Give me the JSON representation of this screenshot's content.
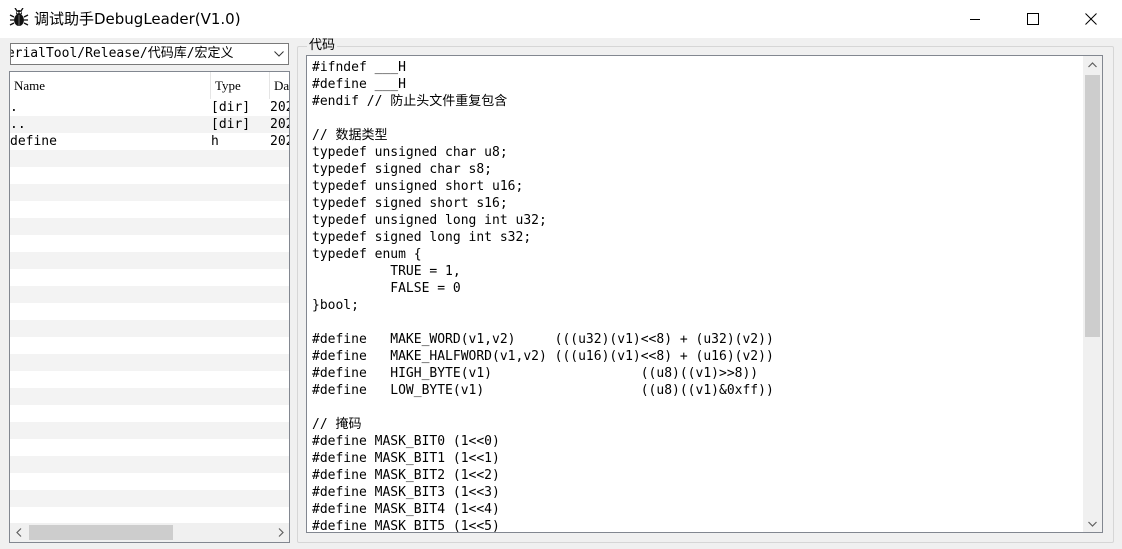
{
  "window": {
    "title": "调试助手DebugLeader(V1.0)",
    "minimize_glyph": "—",
    "maximize_glyph": "☐",
    "close_glyph": "✕"
  },
  "path_combo": {
    "value": "SerialTool/Release/代码库/宏定义"
  },
  "file_list": {
    "columns": [
      "Name",
      "Type",
      "Da"
    ],
    "rows": [
      {
        "name": ".",
        "type": "[dir]",
        "date": "202"
      },
      {
        "name": "..",
        "type": "[dir]",
        "date": "202"
      },
      {
        "name": "define",
        "type": "h",
        "date": "202"
      }
    ]
  },
  "code_panel": {
    "label": "代码",
    "lines": [
      "#ifndef ___H",
      "#define ___H",
      "#endif // 防止头文件重复包含",
      "",
      "// 数据类型",
      "typedef unsigned char u8;",
      "typedef signed char s8;",
      "typedef unsigned short u16;",
      "typedef signed short s16;",
      "typedef unsigned long int u32;",
      "typedef signed long int s32;",
      "typedef enum {",
      "          TRUE = 1,",
      "          FALSE = 0",
      "}bool;",
      "",
      "#define   MAKE_WORD(v1,v2)     (((u32)(v1)<<8) + (u32)(v2))",
      "#define   MAKE_HALFWORD(v1,v2) (((u16)(v1)<<8) + (u16)(v2))",
      "#define   HIGH_BYTE(v1)                   ((u8)((v1)>>8))",
      "#define   LOW_BYTE(v1)                    ((u8)((v1)&0xff))",
      "",
      "// 掩码",
      "#define MASK_BIT0 (1<<0)",
      "#define MASK_BIT1 (1<<1)",
      "#define MASK_BIT2 (1<<2)",
      "#define MASK_BIT3 (1<<3)",
      "#define MASK_BIT4 (1<<4)",
      "#define MASK_BIT5 (1<<5)"
    ]
  }
}
